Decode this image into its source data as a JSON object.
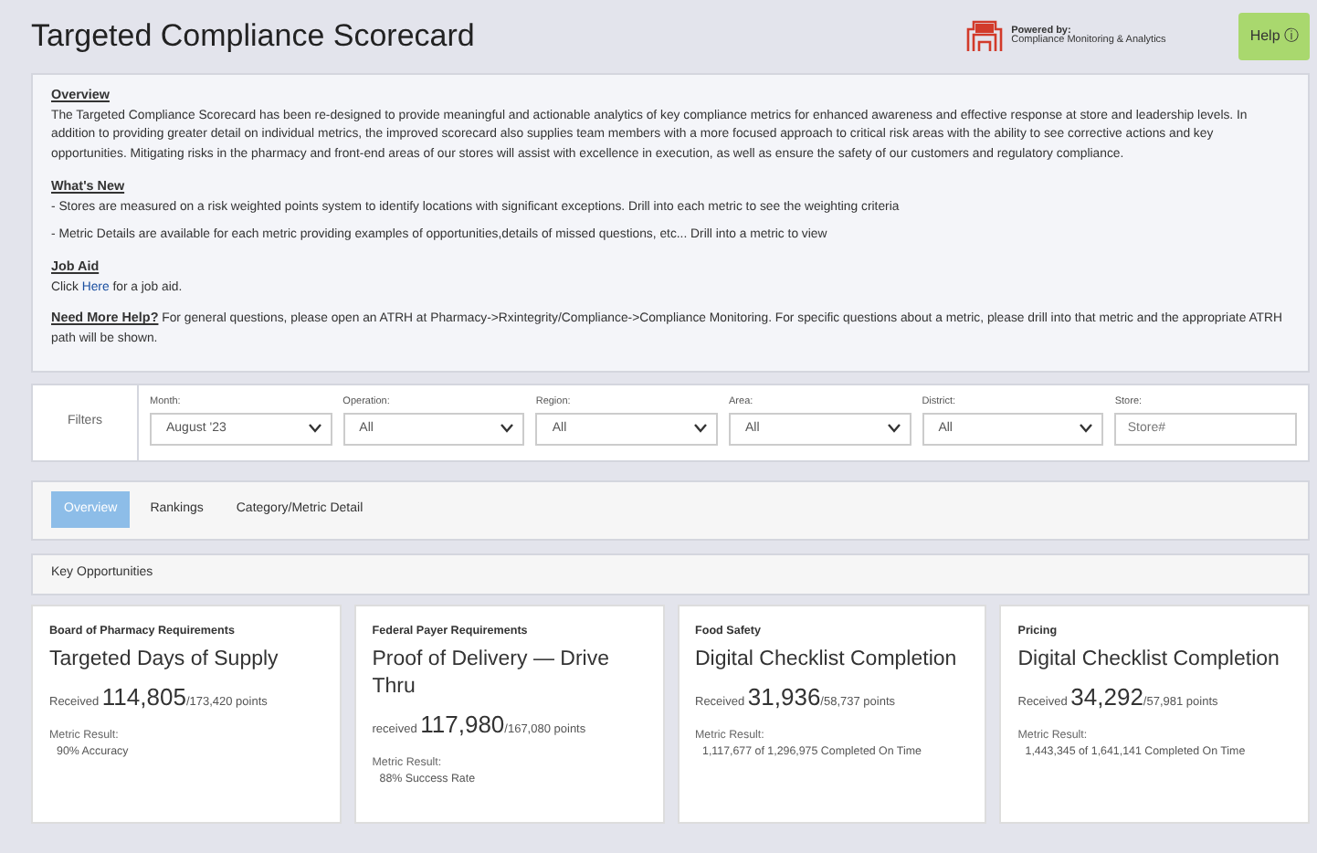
{
  "header": {
    "title": "Targeted Compliance Scorecard",
    "logo": {
      "powered_by": "Powered by:",
      "company": "Compliance Monitoring & Analytics"
    },
    "help_button": "Help ⓘ"
  },
  "info": [
    {
      "kind": "block",
      "heading": "Overview",
      "paragraphs": [
        {
          "text": "The Targeted Compliance Scorecard has been re-designed to provide meaningful and actionable analytics of key compliance metrics for enhanced awareness and effective response at store and leadership levels. In addition to providing greater detail on individual metrics, the improved scorecard also supplies team members with a more focused approach to critical risk areas with the ability to see corrective actions and key opportunities. Mitigating risks in the pharmacy and front-end areas of our stores will assist with excellence in execution, as well as ensure the safety of our customers and regulatory compliance."
        }
      ]
    },
    {
      "kind": "block",
      "heading": "What's New",
      "paragraphs": [
        {
          "text": "- Stores are measured on a risk weighted points system to identify locations with significant exceptions. Drill into each metric to see the weighting criteria"
        },
        {
          "text": "- Metric Details are available for each metric providing examples of opportunities,details of missed questions, etc... Drill into a metric to view"
        }
      ]
    },
    {
      "kind": "block",
      "heading": "Job Aid",
      "paragraphs": [
        {
          "text": "Click ",
          "link": "Here",
          "after": " for a job aid."
        }
      ]
    },
    {
      "kind": "inline",
      "heading": "Need More Help?",
      "paragraphs": [
        {
          "text": "For general questions, please open an ATRH at Pharmacy->Rxintegrity/Compliance->Compliance Monitoring. For specific questions about a metric, please drill into that metric and the appropriate ATRH path will be shown."
        }
      ]
    }
  ],
  "filters": {
    "label": "Filters",
    "fields": [
      {
        "kind": "select",
        "label": "Month:",
        "value": "August '23"
      },
      {
        "kind": "select",
        "label": "Operation:",
        "value": "All"
      },
      {
        "kind": "select",
        "label": "Region:",
        "value": "All"
      },
      {
        "kind": "select",
        "label": "Area:",
        "value": "All"
      },
      {
        "kind": "select",
        "label": "District:",
        "value": "All"
      },
      {
        "kind": "input",
        "label": "Store:",
        "placeholder": "Store#"
      }
    ]
  },
  "tabs": [
    {
      "label": "Overview",
      "selected": true
    },
    {
      "label": "Rankings",
      "selected": false
    },
    {
      "label": "Category/Metric Detail",
      "selected": false
    }
  ],
  "key_opportunities": {
    "title": "Key Opportunities",
    "cards": [
      {
        "category": "Board of Pharmacy Requirements",
        "metric": "Targeted Days of Supply",
        "received_label": "Received",
        "received": "114,805",
        "total": "/173,420",
        "unit": "points",
        "result_label": "Metric Result:",
        "result": "90% Accuracy"
      },
      {
        "category": "Federal Payer Requirements",
        "metric": "Proof of Delivery — Drive Thru",
        "received_label": "received",
        "received": "117,980",
        "total": "/167,080",
        "unit": "points",
        "result_label": "Metric Result:",
        "result": "88% Success Rate"
      },
      {
        "category": "Food Safety",
        "metric": "Digital Checklist Completion",
        "received_label": "Received",
        "received": "31,936",
        "total": "/58,737",
        "unit": "points",
        "result_label": "Metric Result:",
        "result": "1,117,677 of 1,296,975 Completed On Time"
      },
      {
        "category": "Pricing",
        "metric": "Digital Checklist Completion",
        "received_label": "Received",
        "received": "34,292",
        "total": "/57,981",
        "unit": "points",
        "result_label": "Metric Result:",
        "result": "1,443,345 of 1,641,141 Completed On Time"
      }
    ]
  }
}
